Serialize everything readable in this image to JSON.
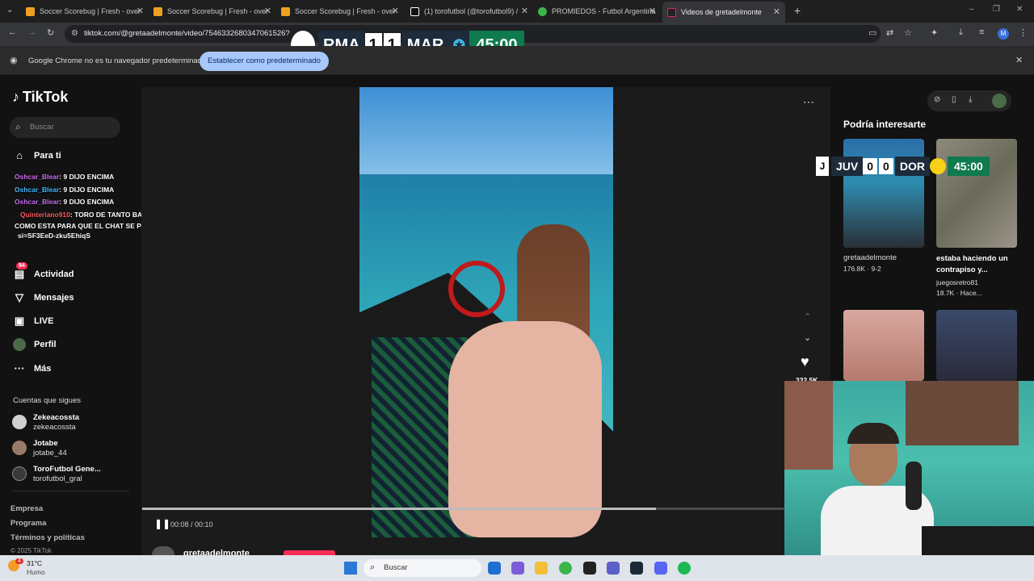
{
  "tabs": [
    {
      "title": "Soccer Scorebug | Fresh - over",
      "favicon_color": "#f0a020"
    },
    {
      "title": "Soccer Scorebug | Fresh - over",
      "favicon_color": "#f0a020"
    },
    {
      "title": "Soccer Scorebug | Fresh - over",
      "favicon_color": "#f0a020"
    },
    {
      "title": "(1) torofutbol (@torofutbol9) /",
      "favicon_color": "#ffffff"
    },
    {
      "title": "PROMIEDOS - Futbol Argentina",
      "favicon_color": "#3bb54a"
    },
    {
      "title": "Videos de gretadelmonte",
      "favicon_color": "#222222"
    }
  ],
  "address_bar": {
    "url": "tiktok.com/@gretaadelmonte/video/75463326803470615​26?"
  },
  "infobar": {
    "message": "Google Chrome no es tu navegador predeterminado",
    "button_label": "Establecer como predeterminado"
  },
  "scoreboard_top": {
    "home": "RMA",
    "home_score": "1",
    "away_score": "1",
    "away": "MAR",
    "time": "45:00"
  },
  "scoreboard_side": {
    "home": "JUV",
    "home_score": "0",
    "away_score": "0",
    "away": "DOR",
    "time": "45:00"
  },
  "tiktok": {
    "logo": "TikTok",
    "search_placeholder": "Buscar",
    "nav": [
      {
        "label": "Para ti",
        "icon": "home-icon"
      },
      {
        "label": "Actividad",
        "icon": "inbox-icon",
        "badge": "94"
      },
      {
        "label": "Mensajes",
        "icon": "send-icon"
      },
      {
        "label": "LIVE",
        "icon": "live-icon"
      },
      {
        "label": "Perfil",
        "icon": "avatar-icon"
      },
      {
        "label": "Más",
        "icon": "more-icon"
      }
    ],
    "following_title": "Cuentas que sigues",
    "following": [
      {
        "name": "Zekeacossta",
        "username": "zekeacossta",
        "color": "#d0d0d0"
      },
      {
        "name": "Jotabe",
        "username": "jotabe_44",
        "color": "#9a7b6a"
      },
      {
        "name": "ToroFutbol Gene...",
        "username": "torofutbol_gral",
        "color": "#3a3a3a"
      }
    ],
    "footer": [
      "Empresa",
      "Programa",
      "Términos y políticas"
    ],
    "copyright": "© 2025 TikTok",
    "player": {
      "time": "00:08 / 00:10",
      "progress": 0.8,
      "author": "gretaadelmonte"
    },
    "like_count": "332.5K",
    "rec_title": "Podría interesarte",
    "recommendations": [
      {
        "title": "gretaadelmonte",
        "stats": "176.8K · 9-2",
        "author": ""
      },
      {
        "title": "estaba haciendo un contrapiso y...",
        "stats": "18.7K · Hace...",
        "author": "juegosretro81"
      }
    ]
  },
  "chat": [
    {
      "user": "Oshcar_Blear",
      "text": ": 9 DIJO ENCIMA",
      "user_class": "u1"
    },
    {
      "user": "Oshcar_Blear",
      "text": ": 9 DIJO ENCIMA",
      "user_class": "u2"
    },
    {
      "user": "Oshcar_Blear",
      "text": ": 9 DIJO ENCIMA",
      "user_class": "u1"
    },
    {
      "user": "Quinteriano910",
      "text": ": TORO DE TANTO BAILAR DEBERIAS HACER UNA CANCION",
      "user_class": "u3"
    },
    {
      "user": "",
      "text": "COMO ESTA PARA QUE EL CHAT SE PAJEE https://youtu.be/BwdxRkM_EPE?",
      "user_class": ""
    },
    {
      "user": "",
      "text": "si=SF3EeD-zku5EhiqS",
      "user_class": ""
    }
  ],
  "taskbar": {
    "weather_temp": "31°C",
    "weather_desc": "Humo",
    "search_label": "Buscar",
    "weather_badge": "4"
  }
}
